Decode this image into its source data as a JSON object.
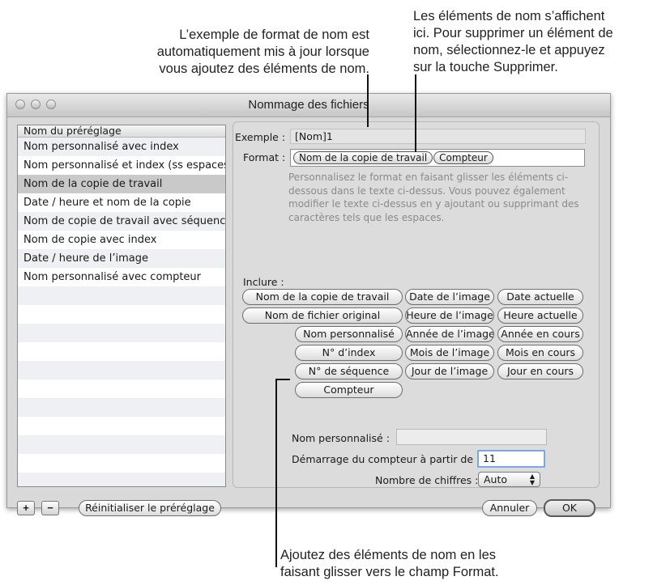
{
  "callouts": {
    "left": [
      "L’exemple de format de nom est",
      "automatiquement mis à jour lorsque",
      "vous ajoutez des éléments de nom."
    ],
    "right": [
      "Les éléments de nom s’affichent",
      "ici. Pour supprimer un élément de",
      "nom, sélectionnez-le et appuyez",
      "sur la touche Supprimer."
    ],
    "bottom": [
      "Ajoutez des éléments de nom en les",
      "faisant glisser vers le champ Format."
    ]
  },
  "window": {
    "title": "Nommage des fichiers"
  },
  "preset_list": {
    "header": "Nom du préréglage",
    "items": [
      "Nom personnalisé avec index",
      "Nom personnalisé et index (ss espaces)",
      "Nom de la copie de travail",
      "Date / heure et nom de la copie",
      "Nom de copie de travail avec séquence",
      "Nom de copie avec index",
      "Date / heure de l’image",
      "Nom personnalisé avec compteur"
    ],
    "selected_index": 2
  },
  "bottom_bar": {
    "add_label": "+",
    "remove_label": "−",
    "reset_label": "Réinitialiser le préréglage",
    "cancel_label": "Annuler",
    "ok_label": "OK"
  },
  "panel": {
    "example_label": "Exemple :",
    "example_value": "[Nom]1",
    "format_label": "Format :",
    "format_tokens": [
      "Nom de la copie de travail",
      "Compteur"
    ],
    "help_text": "Personnalisez le format en faisant glisser les éléments ci-dessous dans le texte ci-dessus. Vous pouvez également modifier le texte ci-dessus en y ajoutant ou supprimant des caractères tels que les espaces.",
    "include_label": "Inclure :",
    "elements": {
      "copy_name": "Nom de la copie de travail",
      "image_date": "Date de l’image",
      "current_date": "Date actuelle",
      "original_filename": "Nom de fichier original",
      "image_time": "Heure de l’image",
      "current_time": "Heure actuelle",
      "custom_name": "Nom personnalisé",
      "image_year": "Année de l’image",
      "current_year": "Année en cours",
      "index_number": "N° d’index",
      "image_month": "Mois de l’image",
      "current_month": "Mois en cours",
      "sequence_number": "N° de séquence",
      "image_day": "Jour de l’image",
      "current_day": "Jour en cours",
      "counter": "Compteur"
    },
    "custom_name_label": "Nom personnalisé :",
    "custom_name_value": "",
    "counter_start_label": "Démarrage du compteur à partir de :",
    "counter_start_value": "11",
    "digits_label": "Nombre de chiffres :",
    "digits_value": "Auto"
  }
}
